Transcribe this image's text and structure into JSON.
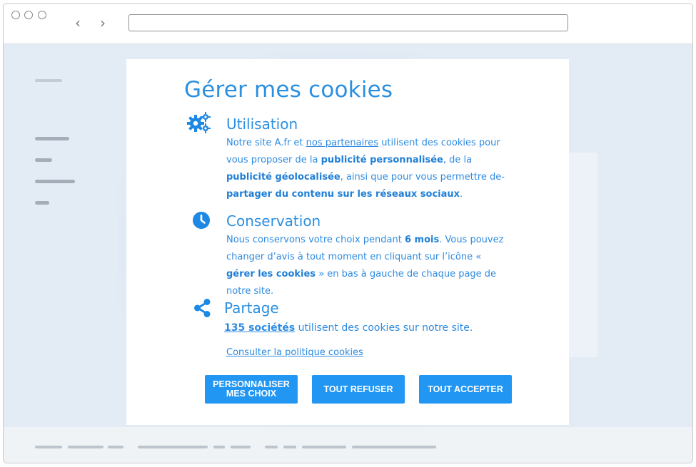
{
  "modal": {
    "title": "Gérer mes cookies",
    "sections": [
      {
        "icon": "gears-icon",
        "heading": "Utilisation",
        "body": {
          "p1": "Notre site A.fr et ",
          "link_partners": "nos partenaires",
          "p2": " utilisent des cookies pour vous proposer de la ",
          "b1": "publicité personnalisée",
          "p3": ", de la ",
          "b2": "publicité géolocalisée",
          "p4": ", ainsi que pour vous permettre de- ",
          "b3": "partager du contenu sur les réseaux sociaux",
          "p5": "."
        }
      },
      {
        "icon": "clock-icon",
        "heading": "Conservation",
        "body": {
          "p1": "Nous conservons votre choix pendant ",
          "b1": "6 mois",
          "p2": ". Vous pouvez changer d’avis à tout moment en cliquant sur l’icône « ",
          "b2": "gérer les cookies",
          "p3": " » en bas à gauche de chaque page de notre site."
        }
      },
      {
        "icon": "share-icon",
        "heading": "Partage",
        "body": {
          "link_companies": "135 sociétés",
          "p1": " utilisent des cookies sur notre site."
        }
      }
    ],
    "policy_link": "Consulter la politique cookies",
    "buttons": {
      "customize": "PERSONNALISER MES CHOIX",
      "refuse": "TOUT REFUSER",
      "accept": "TOUT ACCEPTER"
    }
  },
  "colors": {
    "accent": "#2196f3",
    "text_blue": "#2e8be0",
    "page_background": "#e3ebf4"
  }
}
